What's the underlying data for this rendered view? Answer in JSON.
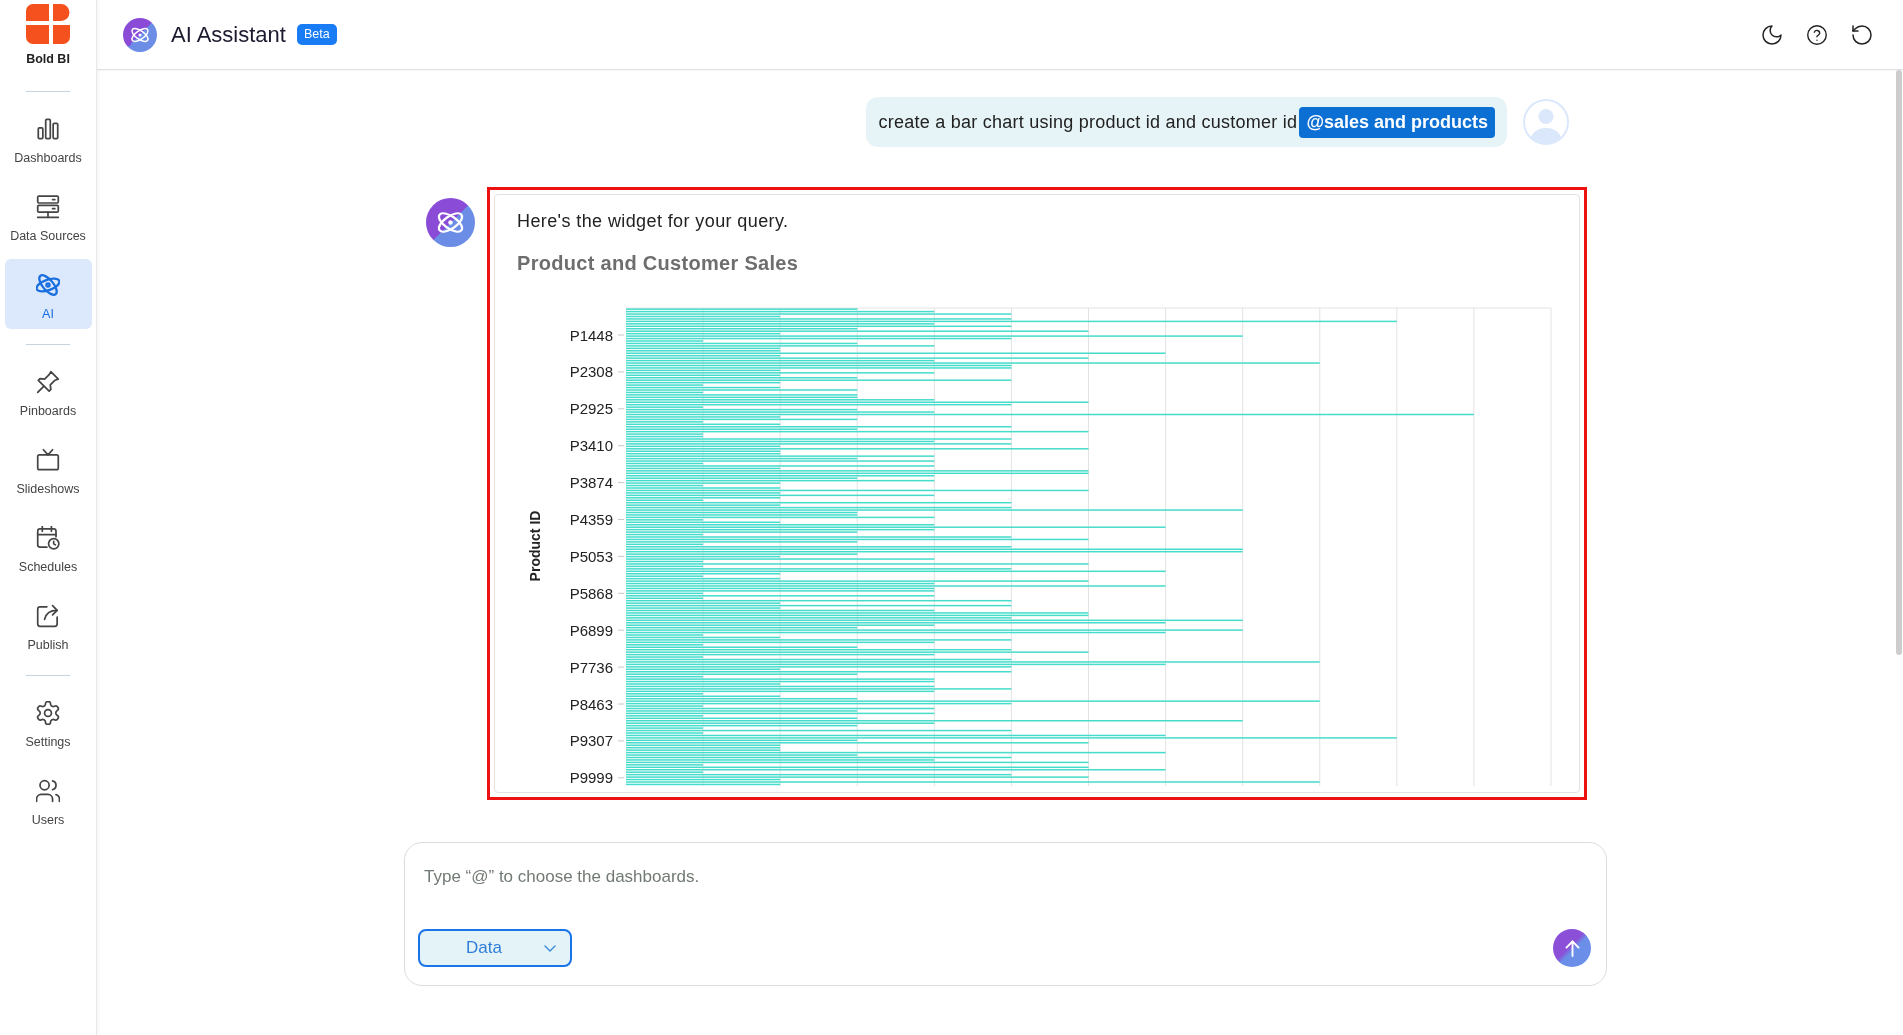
{
  "sidebar": {
    "logo": {
      "label": "Bold BI"
    },
    "groups": [
      {
        "items": [
          {
            "label": "Dashboards",
            "selected": false
          },
          {
            "label": "Data Sources",
            "selected": false
          },
          {
            "label": "AI",
            "selected": true
          }
        ]
      },
      {
        "items": [
          {
            "label": "Pinboards",
            "selected": false
          },
          {
            "label": "Slideshows",
            "selected": false
          },
          {
            "label": "Schedules",
            "selected": false
          },
          {
            "label": "Publish",
            "selected": false
          }
        ]
      },
      {
        "items": [
          {
            "label": "Settings",
            "selected": false
          },
          {
            "label": "Users",
            "selected": false
          }
        ]
      }
    ]
  },
  "header": {
    "title": "AI Assistant",
    "badge": "Beta"
  },
  "messages": [
    {
      "kind": "user",
      "text": "create a bar chart using product id and customer id",
      "mention": "@sales and products"
    },
    {
      "kind": "assistant",
      "highlighted": true,
      "text": "Here's the widget for your query.",
      "widget": {
        "title": "Product and Customer Sales",
        "y_axis_title": "Product ID",
        "y_axis_labels": [
          "P1448",
          "P2308",
          "P2925",
          "P3410",
          "P3874",
          "P4359",
          "P5053",
          "P5868",
          "P6899",
          "P7736",
          "P8463",
          "P9307",
          "P9999"
        ]
      }
    }
  ],
  "composer": {
    "placeholder": "Type “@” to choose the dashboards.",
    "mode": "Data"
  }
}
